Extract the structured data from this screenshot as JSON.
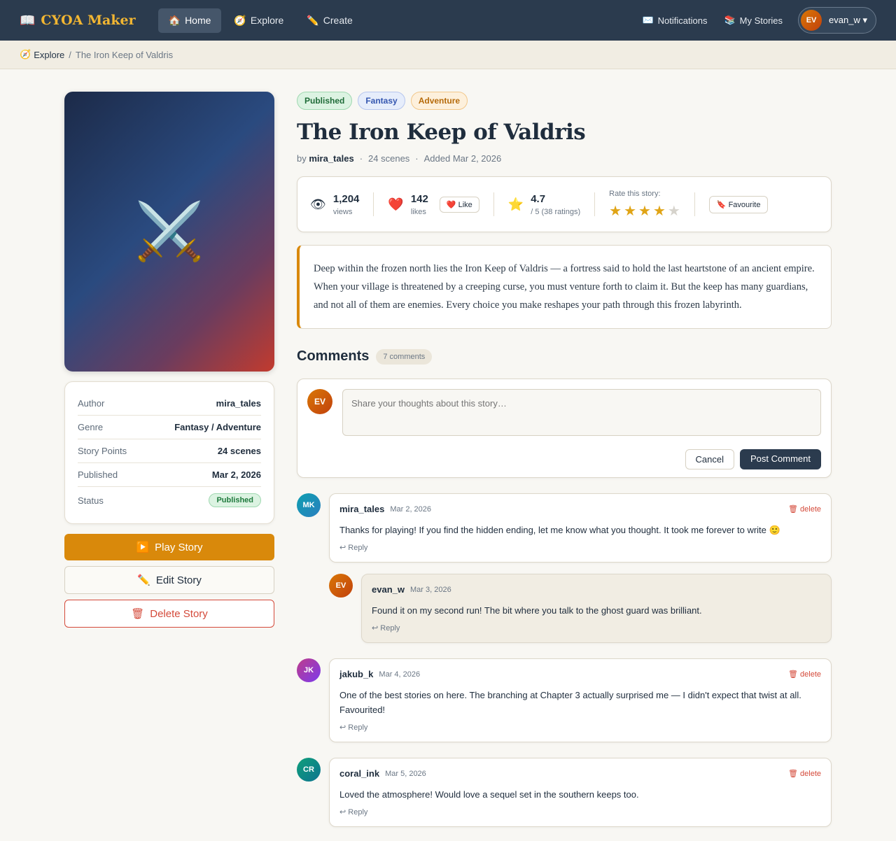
{
  "nav": {
    "brand": "CYOA Maker",
    "brand_icon": "📖",
    "links": [
      {
        "icon": "🏠",
        "label": "Home"
      },
      {
        "icon": "🧭",
        "label": "Explore"
      },
      {
        "icon": "✏️",
        "label": "Create"
      }
    ],
    "notifications": {
      "icon": "✉️",
      "label": "Notifications"
    },
    "my_stories": {
      "icon": "📚",
      "label": "My Stories"
    },
    "user": {
      "initials": "EV",
      "name": "evan_w ▾"
    }
  },
  "breadcrumb": {
    "icon": "🧭",
    "parent": "Explore",
    "separator": "/",
    "current": "The Iron Keep of Valdris"
  },
  "cover": {
    "icon": "⚔️"
  },
  "info": {
    "rows": [
      {
        "label": "Author",
        "value": "mira_tales"
      },
      {
        "label": "Genre",
        "value": "Fantasy / Adventure"
      },
      {
        "label": "Story Points",
        "value": "24 scenes"
      },
      {
        "label": "Published",
        "value": "Mar 2, 2026"
      }
    ],
    "status_label": "Status",
    "status_value": "Published"
  },
  "actions": {
    "play": {
      "icon": "▶️",
      "label": "Play Story"
    },
    "edit": {
      "icon": "✏️",
      "label": "Edit Story"
    },
    "delete": {
      "icon": "🗑",
      "label": "Delete Story"
    }
  },
  "story": {
    "tags": [
      "Published",
      "Fantasy",
      "Adventure"
    ],
    "title": "The Iron Keep of Valdris",
    "by": "by",
    "author": "mira_tales",
    "dot": "·",
    "scenes": "24 scenes",
    "added": "Added Mar 2, 2026",
    "description": "Deep within the frozen north lies the Iron Keep of Valdris — a fortress said to hold the last heartstone of an ancient empire. When your village is threatened by a creeping curse, you must venture forth to claim it. But the keep has many guardians, and not all of them are enemies. Every choice you make reshapes your path through this frozen labyrinth."
  },
  "stats": {
    "views": {
      "icon": "👁",
      "value": "1,204",
      "label": "views"
    },
    "likes": {
      "icon": "❤️",
      "value": "142",
      "label": "likes",
      "button": "❤️ Like"
    },
    "rating": {
      "icon": "⭐",
      "value": "4.7",
      "label": "/ 5 (38 ratings)"
    },
    "rate": {
      "label": "Rate this story:",
      "stars": 4,
      "max": 5,
      "star_char": "★"
    },
    "favourite": "🔖 Favourite"
  },
  "comments": {
    "title": "Comments",
    "count": "7 comments",
    "composer": {
      "initials": "EV",
      "placeholder": "Share your thoughts about this story…",
      "cancel": "Cancel",
      "post": "Post Comment"
    },
    "delete_label": "🗑 delete",
    "reply_label": "↩ Reply",
    "items": [
      {
        "initials": "MK",
        "author": "mira_tales",
        "date": "Mar 2, 2026",
        "text": "Thanks for playing! If you find the hidden ending, let me know what you thought. It took me forever to write 🙂"
      },
      {
        "initials": "EV",
        "author": "evan_w",
        "date": "Mar 3, 2026",
        "text": "Found it on my second run! The bit where you talk to the ghost guard was brilliant."
      },
      {
        "initials": "JK",
        "author": "jakub_k",
        "date": "Mar 4, 2026",
        "text": "One of the best stories on here. The branching at Chapter 3 actually surprised me — I didn't expect that twist at all. Favourited!"
      },
      {
        "initials": "CR",
        "author": "coral_ink",
        "date": "Mar 5, 2026",
        "text": "Loved the atmosphere! Would love a sequel set in the southern keeps too."
      }
    ]
  }
}
